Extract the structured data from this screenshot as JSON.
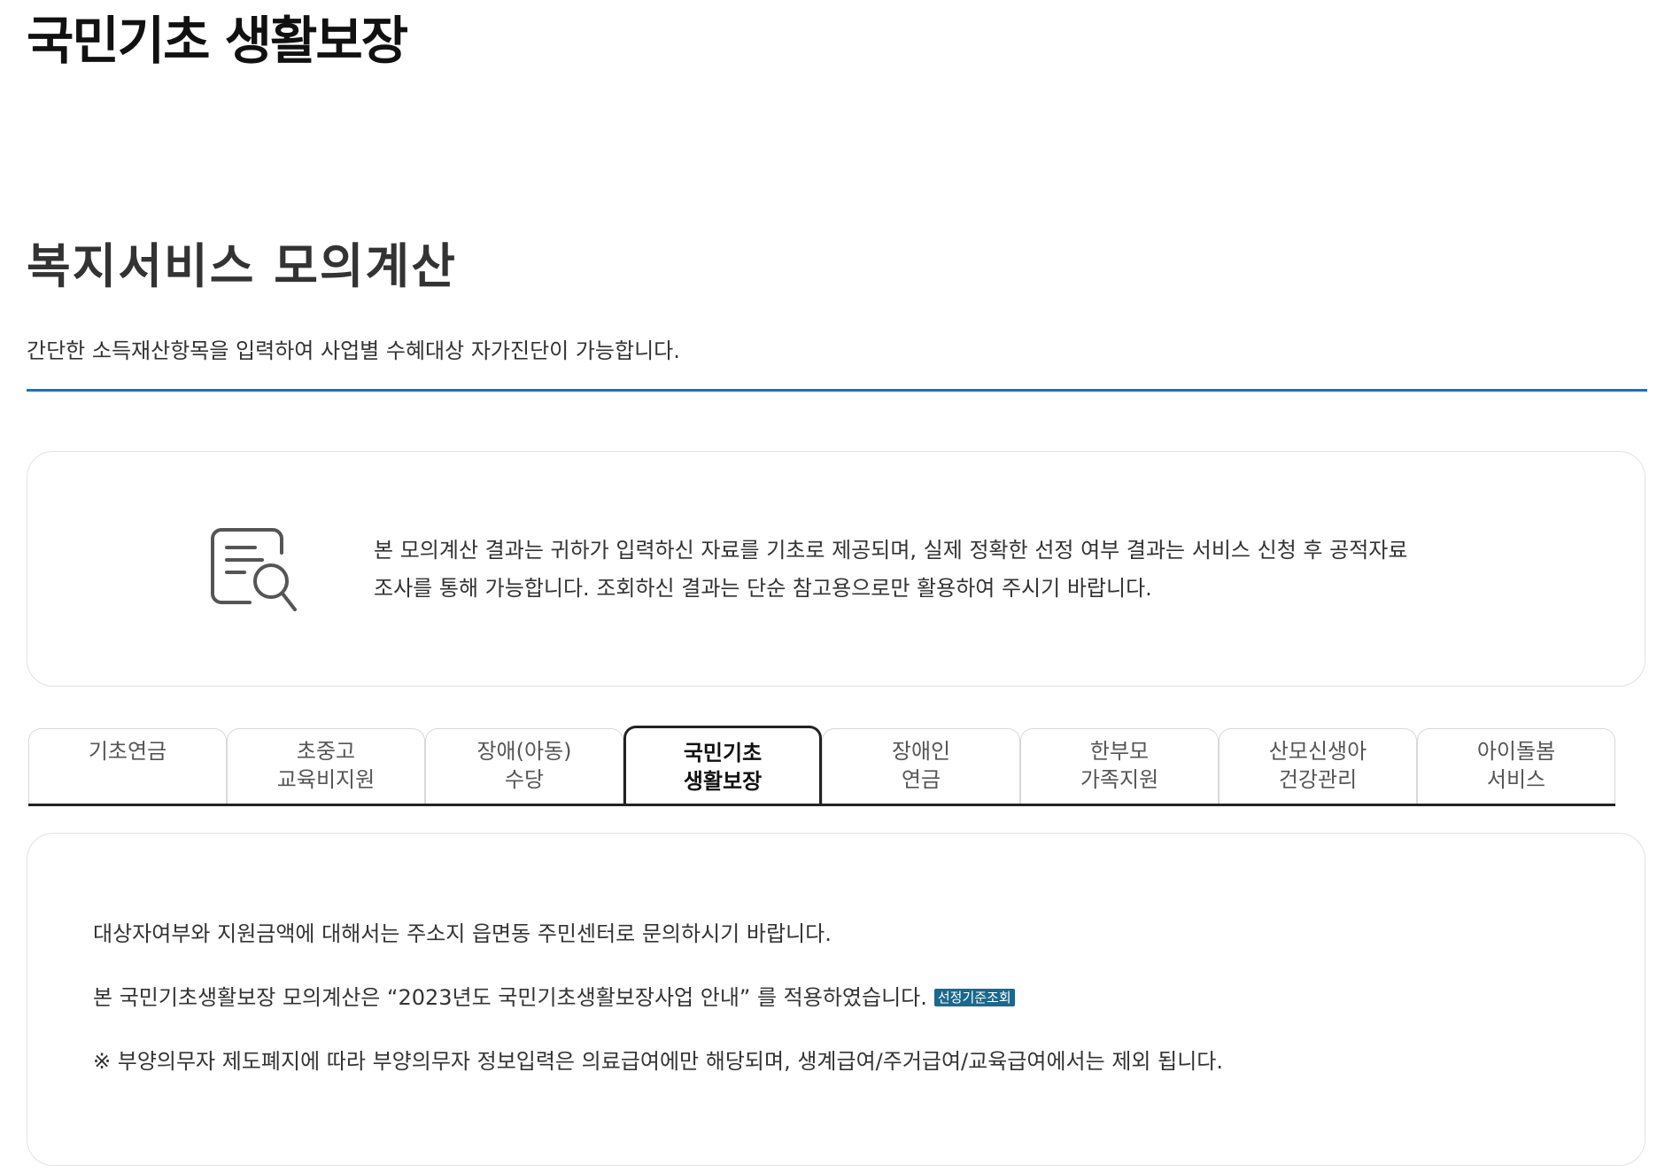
{
  "header": {
    "title": "국민기초 생활보장"
  },
  "section": {
    "title": "복지서비스 모의계산",
    "description": "간단한 소득재산항목을 입력하여 사업별 수혜대상 자가진단이 가능합니다."
  },
  "notice": {
    "icon": "document-search-icon",
    "line1": "본 모의계산 결과는 귀하가 입력하신 자료를 기초로 제공되며, 실제 정확한 선정 여부 결과는 서비스 신청 후 공적자료",
    "line2": "조사를 통해 가능합니다. 조회하신 결과는 단순 참고용으로만 활용하여 주시기 바랍니다."
  },
  "tabs": [
    {
      "label": "기초연금",
      "active": false
    },
    {
      "label": "초중고\n교육비지원",
      "active": false
    },
    {
      "label": "장애(아동)\n수당",
      "active": false
    },
    {
      "label": "국민기초\n생활보장",
      "active": true
    },
    {
      "label": "장애인\n연금",
      "active": false
    },
    {
      "label": "한부모\n가족지원",
      "active": false
    },
    {
      "label": "산모신생아\n건강관리",
      "active": false
    },
    {
      "label": "아이돌봄\n서비스",
      "active": false
    }
  ],
  "info": {
    "line1": "대상자여부와 지원금액에 대해서는 주소지 읍면동 주민센터로 문의하시기 바랍니다.",
    "line2": "본 국민기초생활보장 모의계산은 “2023년도 국민기초생활보장사업 안내” 를 적용하였습니다.",
    "badge": "선정기준조회",
    "line3": "※ 부양의무자 제도폐지에 따라 부양의무자 정보입력은 의료급여에만 해당되며, 생계급여/주거급여/교육급여에서는 제외 됩니다."
  },
  "colors": {
    "accent_rule": "#1473c8",
    "badge_bg": "#19698c"
  }
}
